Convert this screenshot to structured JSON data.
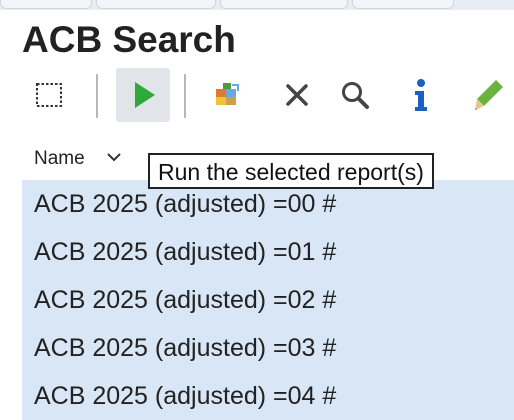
{
  "panel": {
    "title": "ACB Search"
  },
  "toolbar": {
    "buttons": [
      {
        "icon": "select-rectangle-icon",
        "active": false
      },
      {
        "icon": "run-icon",
        "active": true,
        "color": "#2eaa3a"
      },
      {
        "icon": "report-tiles-icon",
        "active": false
      },
      {
        "icon": "close-icon",
        "active": false
      },
      {
        "icon": "search-icon",
        "active": false
      },
      {
        "icon": "info-icon",
        "active": false,
        "color": "#1f5fbf"
      },
      {
        "icon": "pencil-icon",
        "active": false,
        "color": "#6cb33e"
      }
    ],
    "tooltip": "Run the selected report(s)"
  },
  "list": {
    "column_header": "Name",
    "selection_color": "#d9e6f6",
    "rows": [
      {
        "label": "ACB 2025 (adjusted) =00 #"
      },
      {
        "label": "ACB 2025 (adjusted) =01 #"
      },
      {
        "label": "ACB 2025 (adjusted) =02 #"
      },
      {
        "label": "ACB 2025 (adjusted) =03 #"
      },
      {
        "label": "ACB 2025 (adjusted) =04 #"
      }
    ]
  }
}
